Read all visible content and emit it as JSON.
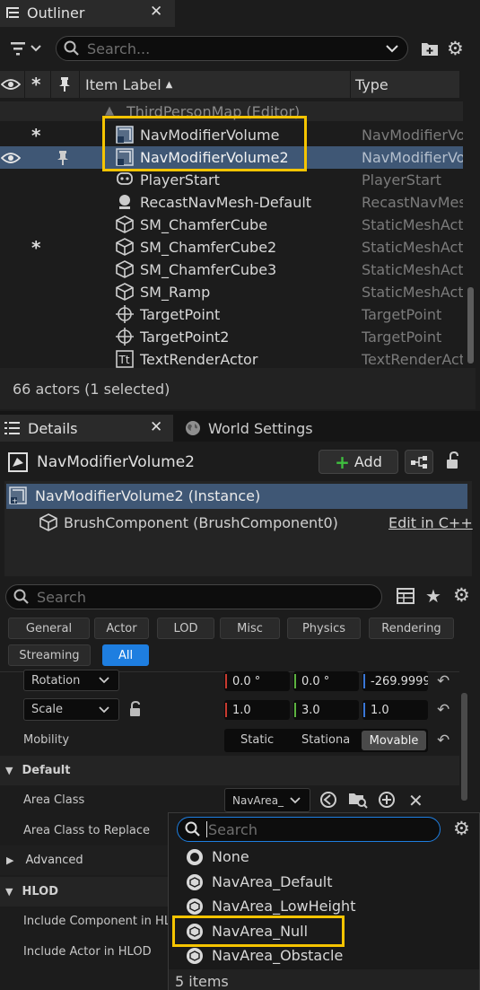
{
  "outliner": {
    "tab_title": "Outliner",
    "search_placeholder": "Search...",
    "columns": {
      "label": "Item Label",
      "type": "Type"
    },
    "partial_row": "ThirdPersonMap (Editor)",
    "rows": [
      {
        "star": "*",
        "label": "NavModifierVolume",
        "type": "NavModifierVolume",
        "icon": "volume-icon"
      },
      {
        "eye": true,
        "pin": true,
        "label": "NavModifierVolume2",
        "type": "NavModifierVolume",
        "icon": "volume-icon",
        "selected": true
      },
      {
        "label": "PlayerStart",
        "type": "PlayerStart",
        "icon": "player-start-icon"
      },
      {
        "label": "RecastNavMesh-Default",
        "type": "RecastNavMesh",
        "icon": "navmesh-icon"
      },
      {
        "label": "SM_ChamferCube",
        "type": "StaticMeshActor",
        "icon": "static-mesh-icon"
      },
      {
        "star": "*",
        "label": "SM_ChamferCube2",
        "type": "StaticMeshActor",
        "icon": "static-mesh-icon"
      },
      {
        "label": "SM_ChamferCube3",
        "type": "StaticMeshActor",
        "icon": "static-mesh-icon"
      },
      {
        "label": "SM_Ramp",
        "type": "StaticMeshActor",
        "icon": "static-mesh-icon"
      },
      {
        "label": "TargetPoint",
        "type": "TargetPoint",
        "icon": "target-point-icon"
      },
      {
        "label": "TargetPoint2",
        "type": "TargetPoint",
        "icon": "target-point-icon"
      },
      {
        "label": "TextRenderActor",
        "type": "TextRenderActor",
        "icon": "text-render-icon"
      }
    ],
    "status": "66 actors (1 selected)"
  },
  "details": {
    "tab_title": "Details",
    "world_settings_tab": "World Settings",
    "actor_name": "NavModifierVolume2",
    "add_label": "Add",
    "instance_label": "NavModifierVolume2 (Instance)",
    "component_label": "BrushComponent (BrushComponent0)",
    "edit_link": "Edit in C++",
    "search_placeholder": "Search",
    "filters": [
      "General",
      "Actor",
      "LOD",
      "Misc",
      "Physics",
      "Rendering",
      "Streaming",
      "All"
    ],
    "active_filter": "All",
    "rotation": {
      "label": "Rotation",
      "x": "0.0 °",
      "y": "0.0 °",
      "z": "-269.9999"
    },
    "scale": {
      "label": "Scale",
      "x": "1.0",
      "y": "3.0",
      "z": "1.0"
    },
    "mobility": {
      "label": "Mobility",
      "options": [
        "Static",
        "Stationa",
        "Movable"
      ],
      "selected": "Movable"
    },
    "section_default": "Default",
    "area_class": {
      "label": "Area Class",
      "value": "NavArea_"
    },
    "area_class_replace": {
      "label": "Area Class to Replace"
    },
    "section_advanced": "Advanced",
    "section_hlod": "HLOD",
    "include_component": "Include Component in HLOD",
    "include_actor": "Include Actor in HLOD"
  },
  "picker": {
    "search_placeholder": "Search",
    "options": [
      "None",
      "NavArea_Default",
      "NavArea_LowHeight",
      "NavArea_Null",
      "NavArea_Obstacle"
    ],
    "count": "5 items"
  },
  "colors": {
    "highlight": "#f5c400",
    "selected_row": "#3f5775",
    "accent": "#1e7ee0"
  }
}
